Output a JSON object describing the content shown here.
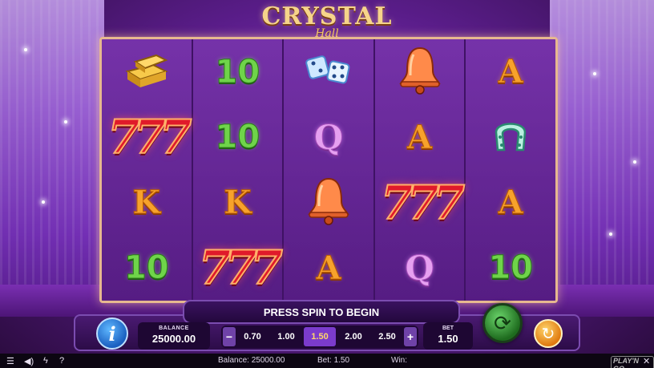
{
  "logo": {
    "main": "CRYSTAL",
    "sub": "Hall"
  },
  "reels": [
    [
      "gold-bars",
      "777",
      "K",
      "10"
    ],
    [
      "10",
      "10",
      "K",
      "777"
    ],
    [
      "dice",
      "Q",
      "bell",
      "A"
    ],
    [
      "bell",
      "A",
      "777",
      "Q"
    ],
    [
      "A",
      "horseshoe",
      "A",
      "10"
    ]
  ],
  "message": "PRESS SPIN TO BEGIN",
  "balance": {
    "label": "BALANCE",
    "value": "25000.00"
  },
  "bet_options": [
    "0.70",
    "1.00",
    "1.50",
    "2.00",
    "2.50"
  ],
  "bet_selected": "1.50",
  "bet": {
    "label": "BET",
    "value": "1.50"
  },
  "controls": {
    "minus": "−",
    "plus": "+"
  },
  "statusbar": {
    "balance": "Balance: 25000.00",
    "bet": "Bet: 1.50",
    "win": "Win:",
    "brand": "PLAY'N GO"
  },
  "colors": {
    "accent": "#7b3bcc",
    "spin": "#2e8b2e",
    "autoplay": "#f0a020",
    "info": "#2a7ae0"
  }
}
